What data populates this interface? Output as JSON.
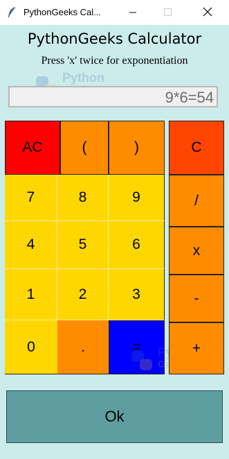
{
  "window": {
    "title": "PythonGeeks Cal...",
    "minimize_icon": "minimize-icon",
    "maximize_icon": "maximize-icon",
    "close_icon": "close-icon",
    "app_icon": "feather-icon"
  },
  "header": {
    "title": "PythonGeeks Calculator",
    "subtitle": "Press 'x' twice for exponentiation"
  },
  "watermark": {
    "line1": "Python",
    "line2": "Geeks"
  },
  "display": {
    "value": "9*6=54"
  },
  "keys": {
    "ac": "AC",
    "lparen": "(",
    "rparen": ")",
    "k7": "7",
    "k8": "8",
    "k9": "9",
    "k4": "4",
    "k5": "5",
    "k6": "6",
    "k1": "1",
    "k2": "2",
    "k3": "3",
    "k0": "0",
    "dot": ".",
    "equals": "="
  },
  "operators": {
    "clear": "C",
    "divide": "/",
    "multiply": "x",
    "subtract": "-",
    "add": "+"
  },
  "ok": {
    "label": "Ok"
  },
  "colors": {
    "background": "#ccebeb",
    "ac": "#ff0000",
    "paren": "#ff8c00",
    "digit": "#ffd700",
    "dot": "#ff8c00",
    "equals": "#0000ff",
    "operator": "#ff8c00",
    "clear": "#ff4500",
    "ok": "#5f9ea0"
  }
}
